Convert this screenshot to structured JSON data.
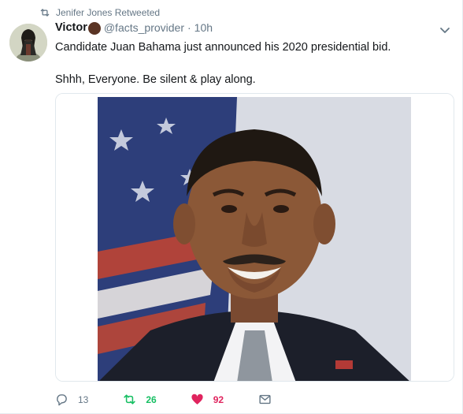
{
  "retweet_context": {
    "text": "Jenifer Jones Retweeted",
    "icon": "retweet-icon"
  },
  "author": {
    "name": "Victor",
    "name_emoji": "raised-fist-emoji",
    "handle": "@facts_provider",
    "separator": "·",
    "time": "10h"
  },
  "tweet": {
    "line1": "Candidate Juan Bahama just announced his 2020 presidential bid.",
    "line2": "Shhh, Everyone. Be silent & play along."
  },
  "actions": {
    "reply_count": "13",
    "retweet_count": "26",
    "like_count": "92"
  },
  "colors": {
    "secondary_text": "#657786",
    "retweet_active": "#17bf63",
    "like_active": "#e0245e",
    "border": "#e1e8ed"
  }
}
